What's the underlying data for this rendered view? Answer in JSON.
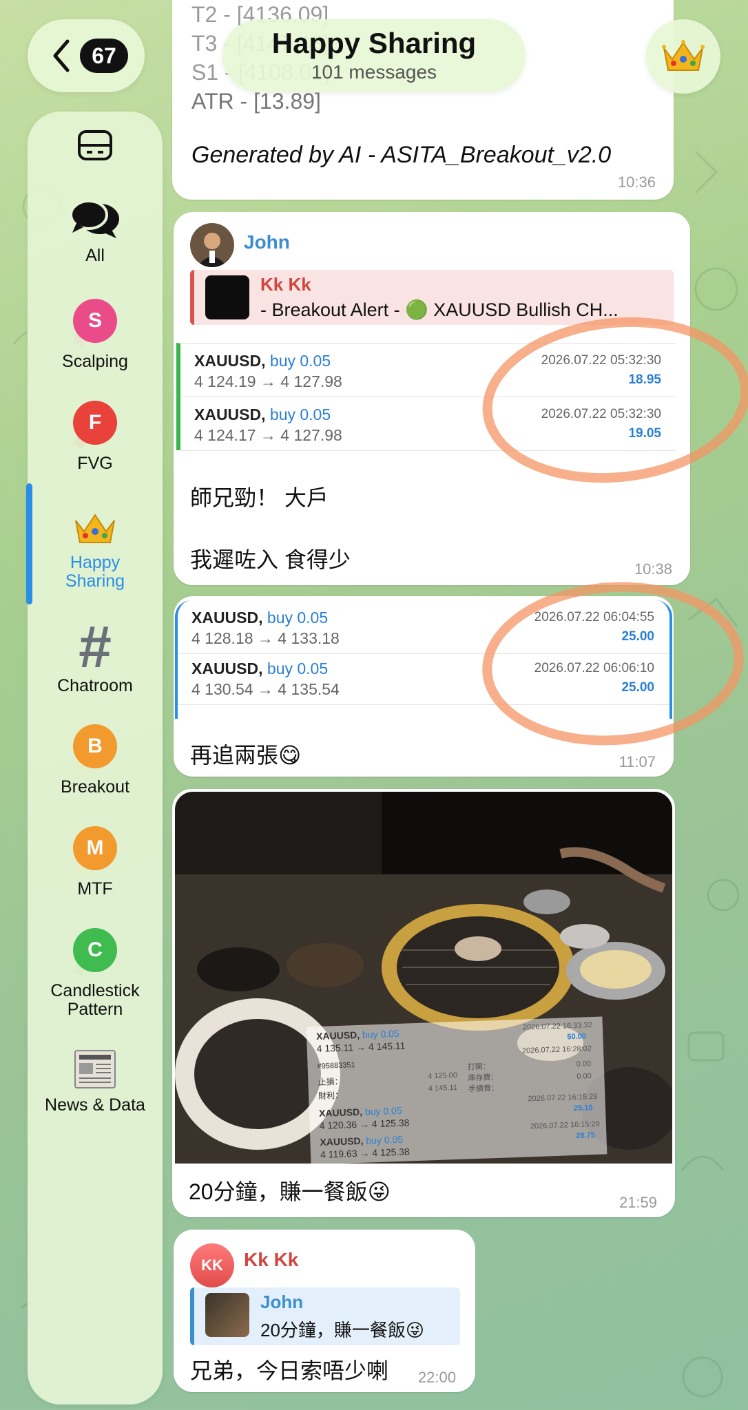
{
  "header": {
    "back_count": "67",
    "title": "Happy Sharing",
    "subtitle": "101 messages"
  },
  "sidebar": {
    "items": [
      {
        "label": "All"
      },
      {
        "label": "Scalping",
        "badge": "S",
        "color": "#ea4c89"
      },
      {
        "label": "FVG",
        "badge": "F",
        "color": "#e8423a"
      },
      {
        "label": "Happy Sharing",
        "active": true
      },
      {
        "label": "Chatroom"
      },
      {
        "label": "Breakout",
        "badge": "B",
        "color": "#f39a2e"
      },
      {
        "label": "MTF",
        "badge": "M",
        "color": "#f39a2e"
      },
      {
        "label": "Candlestick Pattern",
        "badge": "C",
        "color": "#3fbb4f"
      },
      {
        "label": "News & Data"
      }
    ]
  },
  "messages": {
    "m1": {
      "ghost_lines": [
        "T2 - [4136.09]",
        "T3 - [4147.48]",
        "S1 - [4108.01]",
        "ATR - [13.89]"
      ],
      "text": "Generated by AI - ASITA_Breakout_v2.0",
      "time": "10:36"
    },
    "m2": {
      "sender": "John",
      "reply_name": "Kk Kk",
      "reply_text": "- Breakout Alert - 🟢 XAUUSD Bullish CH...",
      "trades": [
        {
          "symbol": "XAUUSD,",
          "side": "buy 0.05",
          "prices": "4 124.19 → 4 127.98",
          "date": "2026.07.22 05:32:30",
          "profit": "18.95"
        },
        {
          "symbol": "XAUUSD,",
          "side": "buy 0.05",
          "prices": "4 124.17 → 4 127.98",
          "date": "2026.07.22 05:32:30",
          "profit": "19.05"
        }
      ],
      "line1": "師兄勁！ 大戶",
      "line2": "我遲咗入 食得少",
      "time": "10:38"
    },
    "m3": {
      "trades": [
        {
          "symbol": "XAUUSD,",
          "side": "buy 0.05",
          "prices": "4 128.18 → 4 133.18",
          "date": "2026.07.22 06:04:55",
          "profit": "25.00"
        },
        {
          "symbol": "XAUUSD,",
          "side": "buy 0.05",
          "prices": "4 130.54 → 4 135.54",
          "date": "2026.07.22 06:06:10",
          "profit": "25.00"
        }
      ],
      "text": "再追兩張😋",
      "time": "11:07"
    },
    "m4": {
      "overlay": {
        "row1_sym": "XAUUSD,",
        "row1_side": "buy 0.05",
        "row1_px": "4 135.11 → 4 145.11",
        "row1_date": "2026.07.22 16:33:32",
        "row1_profit": "50.00",
        "order": "#95883351",
        "d2": "2026.07.22 16:28:02",
        "sl": "止損：",
        "tp": "財利：",
        "open_lbl": "打開：",
        "swap_lbl": "庫存費：",
        "fee_lbl": "手續費：",
        "open_px": "4 125.00",
        "tp_px": "4 145.11",
        "z1": "0.00",
        "z2": "0.00",
        "row2_sym": "XAUUSD,",
        "row2_side": "buy 0.05",
        "row2_px": "4 120.36 → 4 125.38",
        "row2_date": "2026.07.22 16:15:29",
        "row2_profit": "25.10",
        "row3_sym": "XAUUSD,",
        "row3_side": "buy 0.05",
        "row3_px": "4 119.63 → 4 125.38",
        "row3_date": "2026.07.22 16:15:29",
        "row3_profit": "28.75"
      },
      "text": "20分鐘，賺一餐飯😜",
      "time": "21:59"
    },
    "m5": {
      "avatar_initials": "KK",
      "sender": "Kk Kk",
      "reply_name": "John",
      "reply_text": "20分鐘，賺一餐飯😜",
      "text": "兄弟，今日索唔少喇",
      "time": "22:00"
    }
  }
}
